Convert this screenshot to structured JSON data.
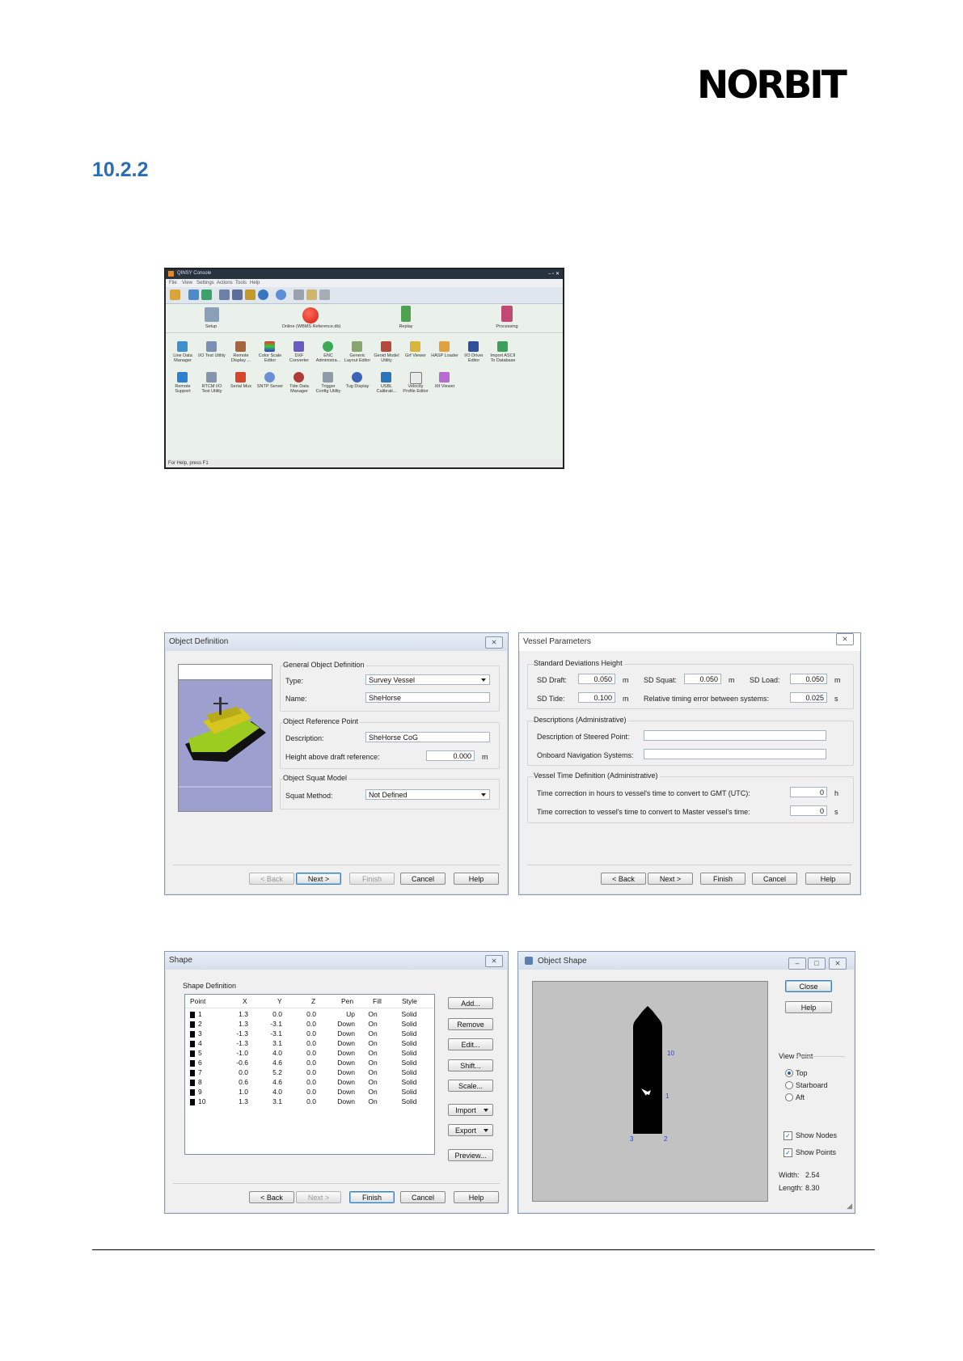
{
  "logo": "NORBIT",
  "heading": "10.2.2",
  "qinsy": {
    "title": "QINSY Console",
    "menu": [
      "File",
      "View",
      "Settings",
      "Actions",
      "Tools",
      "Help"
    ],
    "modes": [
      "Setup",
      "Online (WBMS Reference.db)",
      "Replay",
      "Processing"
    ],
    "tools_row1": [
      "Line Data Manager",
      "I/O Test Utility",
      "Remote Display ...",
      "Color Scale Editor",
      "DXF Converter",
      "ENC Administra...",
      "Generic Layout Editor",
      "Geoid Model Utility",
      "Grf Viewer",
      "HASP Loader",
      "I/O Driver Editor",
      "Import ASCII To Database"
    ],
    "tools_row2": [
      "Remote Support",
      "RTCM I/O Test Utility",
      "Serial Mux",
      "SNTP Server",
      "Tide Data Manager",
      "Trigger Config Utility",
      "Tug Display",
      "USBL Calibrati...",
      "Velocity Profile Editor",
      "Xtf Viewer"
    ],
    "status": "For Help, press F1",
    "colors": {
      "title_bar": "#283340",
      "map": "#e9f1ea"
    }
  },
  "object_definition": {
    "title": "Object Definition",
    "close_icon": "close-icon",
    "general_group": "General Object Definition",
    "type_label": "Type:",
    "type_value": "Survey Vessel",
    "name_label": "Name:",
    "name_value": "SheHorse",
    "ref_group": "Object Reference Point",
    "desc_label": "Description:",
    "desc_value": "SheHorse CoG",
    "height_label": "Height above draft reference:",
    "height_value": "0.000",
    "height_unit": "m",
    "squat_group": "Object Squat Model",
    "squat_label": "Squat Method:",
    "squat_value": "Not Defined",
    "buttons": {
      "back": "< Back",
      "next": "Next >",
      "finish": "Finish",
      "cancel": "Cancel",
      "help": "Help"
    }
  },
  "vessel_parameters": {
    "title": "Vessel Parameters",
    "sd_group": "Standard Deviations Height",
    "sd_draft_label": "SD Draft:",
    "sd_draft_value": "0.050",
    "sd_squat_label": "SD Squat:",
    "sd_squat_value": "0.050",
    "sd_load_label": "SD Load:",
    "sd_load_value": "0.050",
    "sd_tide_label": "SD Tide:",
    "sd_tide_value": "0.100",
    "timing_label": "Relative timing error between systems:",
    "timing_value": "0.025",
    "unit_m": "m",
    "unit_s": "s",
    "unit_h": "h",
    "desc_group": "Descriptions (Administrative)",
    "steered_label": "Description of Steered Point:",
    "nav_label": "Onboard Navigation Systems:",
    "time_group": "Vessel Time Definition (Administrative)",
    "gmt_label": "Time correction in hours to vessel's time to convert to GMT (UTC):",
    "gmt_value": "0",
    "master_label": "Time correction to vessel's time to convert to Master vessel's time:",
    "master_value": "0",
    "buttons": {
      "back": "< Back",
      "next": "Next >",
      "finish": "Finish",
      "cancel": "Cancel",
      "help": "Help"
    }
  },
  "shape": {
    "title": "Shape",
    "group": "Shape Definition",
    "columns": [
      "Point",
      "X",
      "Y",
      "Z",
      "Pen",
      "Fill",
      "Style"
    ],
    "rows": [
      [
        "1",
        "1.3",
        "0.0",
        "0.0",
        "Up",
        "On",
        "Solid"
      ],
      [
        "2",
        "1.3",
        "-3.1",
        "0.0",
        "Down",
        "On",
        "Solid"
      ],
      [
        "3",
        "-1.3",
        "-3.1",
        "0.0",
        "Down",
        "On",
        "Solid"
      ],
      [
        "4",
        "-1.3",
        "3.1",
        "0.0",
        "Down",
        "On",
        "Solid"
      ],
      [
        "5",
        "-1.0",
        "4.0",
        "0.0",
        "Down",
        "On",
        "Solid"
      ],
      [
        "6",
        "-0.6",
        "4.6",
        "0.0",
        "Down",
        "On",
        "Solid"
      ],
      [
        "7",
        "0.0",
        "5.2",
        "0.0",
        "Down",
        "On",
        "Solid"
      ],
      [
        "8",
        "0.6",
        "4.6",
        "0.0",
        "Down",
        "On",
        "Solid"
      ],
      [
        "9",
        "1.0",
        "4.0",
        "0.0",
        "Down",
        "On",
        "Solid"
      ],
      [
        "10",
        "1.3",
        "3.1",
        "0.0",
        "Down",
        "On",
        "Solid"
      ]
    ],
    "side_buttons": {
      "add": "Add...",
      "remove": "Remove",
      "edit": "Edit...",
      "shift": "Shift...",
      "scale": "Scale...",
      "import": "Import",
      "export": "Export",
      "preview": "Preview..."
    },
    "buttons": {
      "back": "< Back",
      "next": "Next >",
      "finish": "Finish",
      "cancel": "Cancel",
      "help": "Help"
    }
  },
  "object_shape": {
    "title": "Object Shape",
    "close": "Close",
    "help": "Help",
    "viewpoint_group": "View Point",
    "options": [
      "Top",
      "Starboard",
      "Aft"
    ],
    "selected": "Top",
    "show_nodes": "Show Nodes",
    "show_points": "Show Points",
    "width_label": "Width:",
    "width_value": "2.54",
    "length_label": "Length:",
    "length_value": "8.30",
    "node_labels": [
      "10",
      "1",
      "3",
      "2"
    ]
  }
}
